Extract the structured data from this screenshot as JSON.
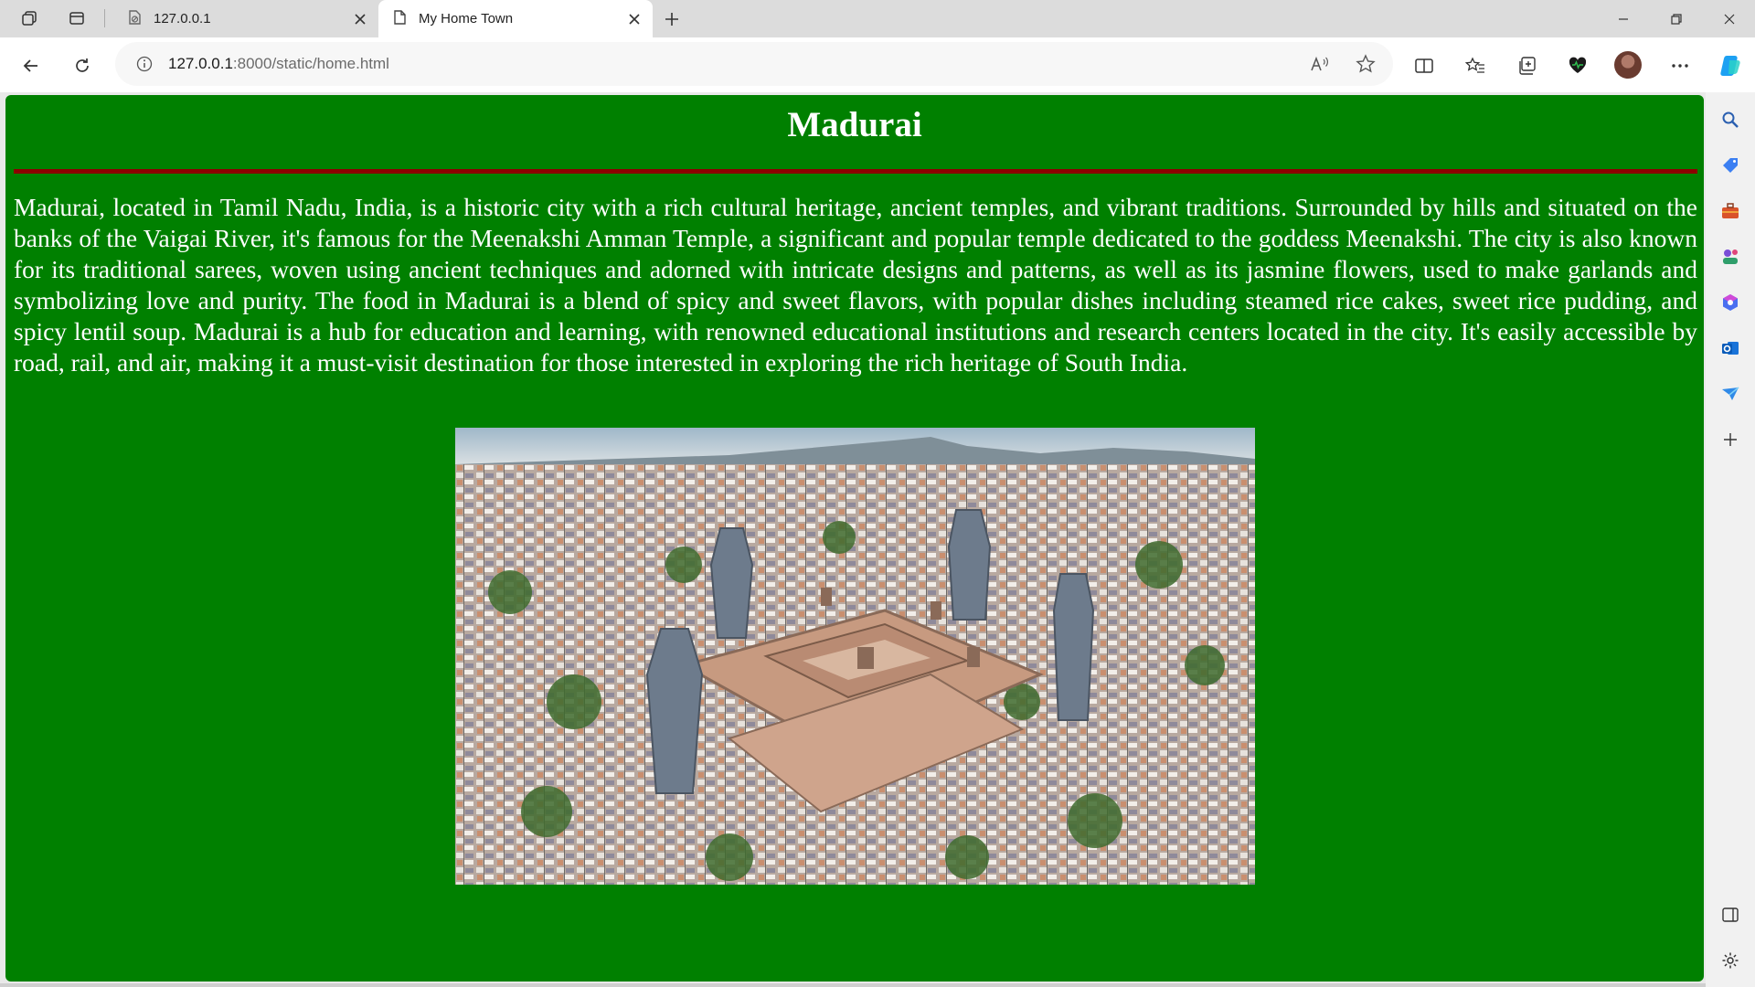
{
  "browser": {
    "tabs": [
      {
        "label": "127.0.0.1",
        "active": false
      },
      {
        "label": "My Home Town",
        "active": true
      }
    ],
    "address": {
      "host": "127.0.0.1",
      "rest": ":8000/static/home.html"
    }
  },
  "page": {
    "heading": "Madurai",
    "paragraph": "Madurai, located in Tamil Nadu, India, is a historic city with a rich cultural heritage, ancient temples, and vibrant traditions. Surrounded by hills and situated on the banks of the Vaigai River, it's famous for the Meenakshi Amman Temple, a significant and popular temple dedicated to the goddess Meenakshi. The city is also known for its traditional sarees, woven using ancient techniques and adorned with intricate designs and patterns, as well as its jasmine flowers, used to make garlands and symbolizing love and purity. The food in Madurai is a blend of spicy and sweet flavors, with popular dishes including steamed rice cakes, sweet rice pudding, and spicy lentil soup. Madurai is a hub for education and learning, with renowned educational institutions and research centers located in the city. It's easily accessible by road, rail, and air, making it a must-visit destination for those interested in exploring the rich heritage of South India.",
    "image_subject": "aerial view of Meenakshi Amman Temple and city",
    "colors": {
      "background": "#008000",
      "rule": "#8b0000",
      "text": "#ffffff"
    }
  }
}
